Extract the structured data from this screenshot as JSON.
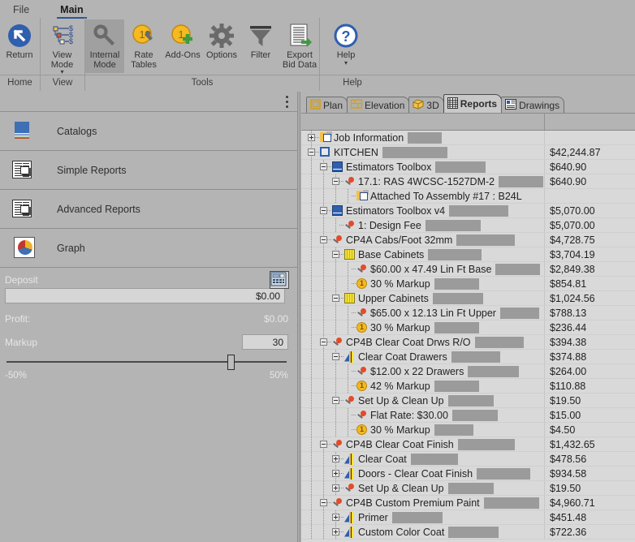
{
  "ribbon": {
    "tabs": [
      {
        "label": "File",
        "active": false
      },
      {
        "label": "Main",
        "active": true
      }
    ],
    "groups": [
      {
        "name": "Home",
        "footer": "Home",
        "buttons": [
          {
            "label": "Return",
            "icon": "return-arrow-icon",
            "selected": false
          }
        ]
      },
      {
        "name": "View",
        "footer": "View",
        "buttons": [
          {
            "label": "View Mode",
            "icon": "view-mode-icon",
            "selected": false,
            "dropdown": true
          }
        ]
      },
      {
        "name": "Tools",
        "footer": "Tools",
        "buttons": [
          {
            "label": "Internal Mode",
            "icon": "key-icon",
            "selected": true
          },
          {
            "label": "Rate Tables",
            "icon": "coin-wrench-icon",
            "selected": false
          },
          {
            "label": "Add-Ons",
            "icon": "coin-plus-icon",
            "selected": false
          },
          {
            "label": "Options",
            "icon": "gear-icon",
            "selected": false
          },
          {
            "label": "Filter",
            "icon": "funnel-icon",
            "selected": false
          },
          {
            "label": "Export Bid Data",
            "icon": "export-document-icon",
            "selected": false
          }
        ]
      },
      {
        "name": "Help",
        "footer": "Help",
        "buttons": [
          {
            "label": "Help",
            "icon": "question-circle-icon",
            "selected": false,
            "dropdown": true
          }
        ]
      }
    ]
  },
  "sidebar": {
    "items": [
      {
        "label": "Catalogs",
        "icon": "book-icon"
      },
      {
        "label": "Simple Reports",
        "icon": "report-icon"
      },
      {
        "label": "Advanced Reports",
        "icon": "report-icon"
      },
      {
        "label": "Graph",
        "icon": "pie-chart-icon"
      }
    ],
    "deposit": {
      "label": "Deposit",
      "value": "$0.00",
      "calc_button": "calculator-button"
    },
    "profit": {
      "label": "Profit:",
      "value": "$0.00"
    },
    "markup": {
      "label": "Markup",
      "value": "30",
      "min_label": "-50%",
      "max_label": "50%",
      "thumb_pct": 80
    }
  },
  "viewtabs": [
    {
      "label": "Plan",
      "icon": "plan-icon",
      "active": false
    },
    {
      "label": "Elevation",
      "icon": "elevation-icon",
      "active": false
    },
    {
      "label": "3D",
      "icon": "cube-icon",
      "active": false
    },
    {
      "label": "Reports",
      "icon": "reports-grid-icon",
      "active": true
    },
    {
      "label": "Drawings",
      "icon": "drawings-icon",
      "active": false
    }
  ],
  "tree": {
    "rows": [
      {
        "depth": 0,
        "label": "Job Information",
        "amount": "",
        "icon": "note-check-icon",
        "expander": "plus",
        "redact": 42
      },
      {
        "depth": 0,
        "label": "KITCHEN",
        "amount": "$42,244.87",
        "icon": "white-box-icon",
        "expander": "minus",
        "redact": 80
      },
      {
        "depth": 1,
        "label": "Estimators Toolbox",
        "amount": "$640.90",
        "icon": "blue-book-icon",
        "expander": "minus",
        "redact": 62
      },
      {
        "depth": 2,
        "label": "17.1: RAS 4WCSC-1527DM-2",
        "amount": "$640.90",
        "icon": "pin-icon",
        "expander": "minus",
        "redact": 55
      },
      {
        "depth": 3,
        "label": "Attached To Assembly #17 : B24L",
        "amount": "",
        "icon": "note-check-icon",
        "expander": "none",
        "redact": 0
      },
      {
        "depth": 1,
        "label": "Estimators Toolbox v4",
        "amount": "$5,070.00",
        "icon": "blue-book-icon",
        "expander": "minus",
        "redact": 73
      },
      {
        "depth": 2,
        "label": "1: Design Fee",
        "amount": "$5,070.00",
        "icon": "pin-icon",
        "expander": "none",
        "redact": 68
      },
      {
        "depth": 1,
        "label": "CP4A Cabs/Foot 32mm",
        "amount": "$4,728.75",
        "icon": "pin-icon",
        "expander": "minus",
        "redact": 72
      },
      {
        "depth": 2,
        "label": "Base Cabinets",
        "amount": "$3,704.19",
        "icon": "cabinet-icon",
        "expander": "minus",
        "redact": 66
      },
      {
        "depth": 3,
        "label": "$60.00 x 47.49 Lin Ft Base",
        "amount": "$2,849.38",
        "icon": "pin-icon",
        "expander": "none",
        "redact": 55
      },
      {
        "depth": 3,
        "label": "30 % Markup",
        "amount": "$854.81",
        "icon": "coin-icon",
        "expander": "none",
        "redact": 55
      },
      {
        "depth": 2,
        "label": "Upper Cabinets",
        "amount": "$1,024.56",
        "icon": "cabinet-icon",
        "expander": "minus",
        "redact": 62
      },
      {
        "depth": 3,
        "label": "$65.00 x 12.13 Lin Ft Upper",
        "amount": "$788.13",
        "icon": "pin-icon",
        "expander": "none",
        "redact": 48
      },
      {
        "depth": 3,
        "label": "30 % Markup",
        "amount": "$236.44",
        "icon": "coin-icon",
        "expander": "none",
        "redact": 55
      },
      {
        "depth": 1,
        "label": "CP4B Clear Coat Drws R/O",
        "amount": "$394.38",
        "icon": "pin-icon",
        "expander": "minus",
        "redact": 60
      },
      {
        "depth": 2,
        "label": "Clear Coat Drawers",
        "amount": "$374.88",
        "icon": "brush-icon",
        "expander": "minus",
        "redact": 60
      },
      {
        "depth": 3,
        "label": "$12.00 x 22 Drawers",
        "amount": "$264.00",
        "icon": "pin-icon",
        "expander": "none",
        "redact": 63
      },
      {
        "depth": 3,
        "label": "42 % Markup",
        "amount": "$110.88",
        "icon": "coin-icon",
        "expander": "none",
        "redact": 55
      },
      {
        "depth": 2,
        "label": "Set Up & Clean Up",
        "amount": "$19.50",
        "icon": "pin-icon",
        "expander": "minus",
        "redact": 56
      },
      {
        "depth": 3,
        "label": "Flat Rate: $30.00",
        "amount": "$15.00",
        "icon": "pin-icon",
        "expander": "none",
        "redact": 56
      },
      {
        "depth": 3,
        "label": "30 % Markup",
        "amount": "$4.50",
        "icon": "coin-icon",
        "expander": "none",
        "redact": 48
      },
      {
        "depth": 1,
        "label": "CP4B Clear Coat Finish",
        "amount": "$1,432.65",
        "icon": "pin-icon",
        "expander": "minus",
        "redact": 70
      },
      {
        "depth": 2,
        "label": "Clear Coat",
        "amount": "$478.56",
        "icon": "brush-icon",
        "expander": "plus",
        "redact": 58
      },
      {
        "depth": 2,
        "label": "Doors - Clear Coat Finish",
        "amount": "$934.58",
        "icon": "brush-icon",
        "expander": "plus",
        "redact": 66
      },
      {
        "depth": 2,
        "label": "Set Up & Clean Up",
        "amount": "$19.50",
        "icon": "pin-icon",
        "expander": "plus",
        "redact": 56
      },
      {
        "depth": 1,
        "label": "CP4B Custom Premium Paint",
        "amount": "$4,960.71",
        "icon": "pin-icon",
        "expander": "minus",
        "redact": 68
      },
      {
        "depth": 2,
        "label": "Primer",
        "amount": "$451.48",
        "icon": "brush-icon",
        "expander": "plus",
        "redact": 62
      },
      {
        "depth": 2,
        "label": "Custom Color Coat",
        "amount": "$722.36",
        "icon": "brush-icon",
        "expander": "plus",
        "redact": 62
      }
    ]
  },
  "colors": {
    "chrome": "#b4b4b4",
    "grid_bg": "#d9d9d9",
    "accent_blue": "#2f5fae",
    "accent_orange": "#f5b921",
    "redaction": "#9b9b9b",
    "tab_underline": "#2b5797"
  }
}
